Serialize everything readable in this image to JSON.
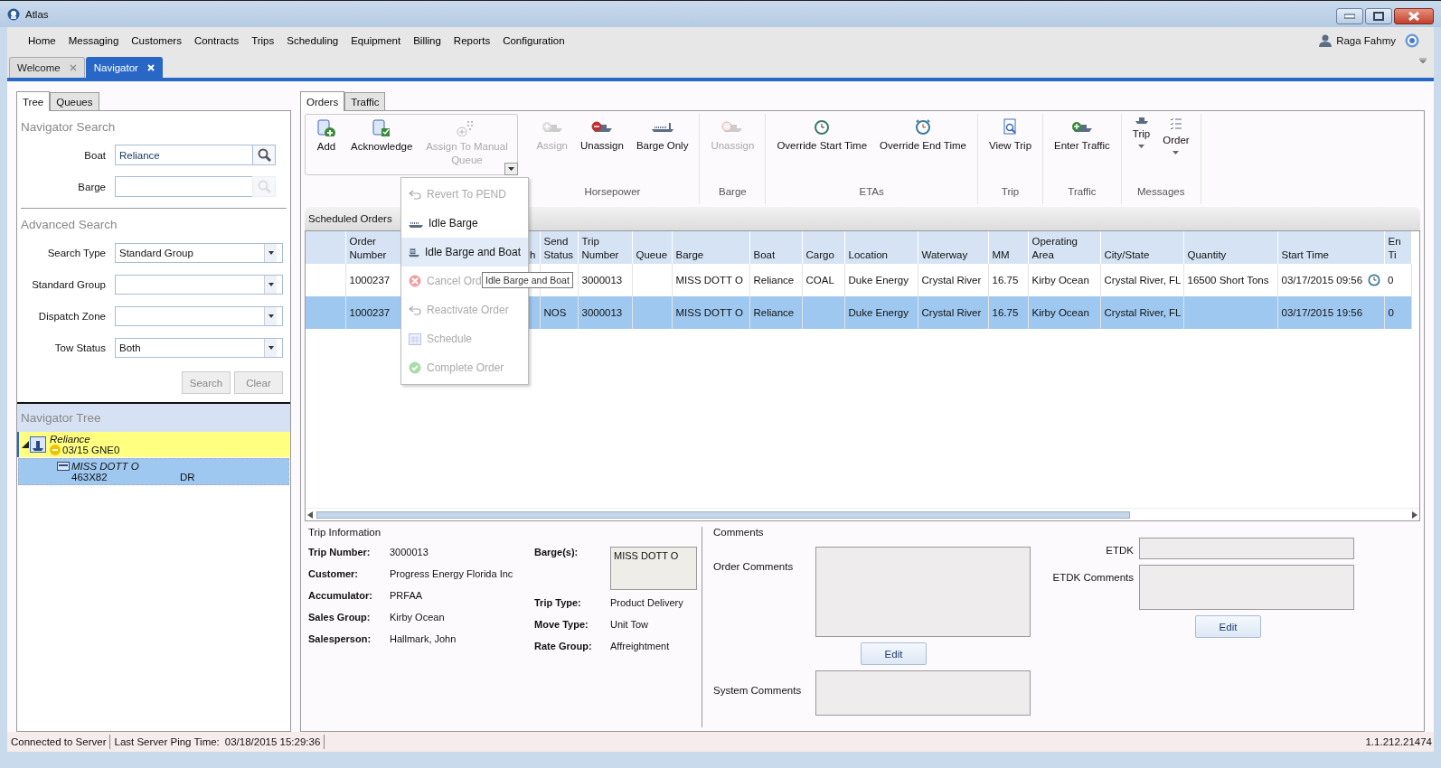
{
  "window": {
    "title": "Atlas"
  },
  "menu": [
    "Home",
    "Messaging",
    "Customers",
    "Contracts",
    "Trips",
    "Scheduling",
    "Equipment",
    "Billing",
    "Reports",
    "Configuration"
  ],
  "user": {
    "name": "Raga Fahmy"
  },
  "doc_tabs": [
    {
      "label": "Welcome",
      "selected": false
    },
    {
      "label": "Navigator",
      "selected": true
    }
  ],
  "left_tabs": [
    {
      "label": "Tree",
      "selected": true
    },
    {
      "label": "Queues",
      "selected": false
    }
  ],
  "navigator_search": {
    "title": "Navigator Search",
    "fields": [
      {
        "label": "Boat",
        "value": "Reliance",
        "disabled": false
      },
      {
        "label": "Barge",
        "disabled": true
      }
    ]
  },
  "advanced_search": {
    "title": "Advanced Search",
    "fields": [
      {
        "label": "Search Type",
        "value": "Standard Group"
      },
      {
        "label": "Standard Group"
      },
      {
        "label": "Dispatch Zone"
      },
      {
        "label": "Tow Status",
        "value": "Both"
      }
    ],
    "buttons": [
      {
        "label": "Search",
        "disabled": true
      },
      {
        "label": "Clear",
        "disabled": true
      }
    ]
  },
  "navigator_tree": {
    "title": "Navigator Tree",
    "nodes": [
      {
        "kind": "boat",
        "name": "Reliance",
        "detail": "03/15  GNE0",
        "expanded": true,
        "selected": false,
        "color": "#ffff80",
        "children": [
          {
            "kind": "barge",
            "name": "MISS DOTT O",
            "detail": "463X82",
            "code": "DR",
            "selected": true
          }
        ]
      }
    ]
  },
  "main_tabs": [
    {
      "label": "Orders",
      "selected": true
    },
    {
      "label": "Traffic",
      "selected": false
    }
  ],
  "ribbon": {
    "groups": [
      {
        "framed": true,
        "buttons": [
          {
            "label": "Add",
            "kind": "add",
            "disabled": false
          },
          {
            "label": "Acknowledge",
            "kind": "acknowledge",
            "disabled": false
          },
          {
            "label": "Assign To Manual Queue",
            "kind": "queue",
            "disabled": true
          }
        ],
        "menu": {
          "items": [
            {
              "label": "Revert To PEND",
              "kind": "undo",
              "disabled": true,
              "hovered": false
            },
            {
              "label": "Idle Barge",
              "kind": "barge",
              "disabled": false,
              "hovered": false
            },
            {
              "label": "Idle Barge and Boat",
              "kind": "boat",
              "disabled": false,
              "hovered": true,
              "tooltip": "Idle Barge and Boat"
            },
            {
              "label": "Cancel Ord",
              "kind": "cancel",
              "disabled": true,
              "hovered": false
            },
            {
              "label": "Reactivate Order",
              "kind": "undo",
              "disabled": true,
              "hovered": false
            },
            {
              "label": "Schedule",
              "kind": "calendar",
              "disabled": true,
              "hovered": false
            },
            {
              "label": "Complete Order",
              "kind": "check",
              "disabled": true,
              "hovered": false
            }
          ]
        }
      },
      {
        "label": "Horsepower",
        "buttons": [
          {
            "label": "Assign",
            "kind": "assign",
            "disabled": true
          },
          {
            "label": "Unassign",
            "kind": "unassign",
            "disabled": false
          },
          {
            "label": "Barge Only",
            "kind": "barge",
            "disabled": false
          }
        ]
      },
      {
        "label": "Barge",
        "buttons": [
          {
            "label": "Unassign",
            "kind": "unassign",
            "disabled": true
          }
        ]
      },
      {
        "label": "ETAs",
        "buttons": [
          {
            "label": "Override Start Time",
            "kind": "clock",
            "disabled": false
          },
          {
            "label": "Override End Time",
            "kind": "alarm",
            "disabled": false
          }
        ]
      },
      {
        "label": "Trip",
        "buttons": [
          {
            "label": "View Trip",
            "kind": "view",
            "disabled": false
          }
        ]
      },
      {
        "label": "Traffic",
        "buttons": [
          {
            "label": "Enter Traffic",
            "kind": "assign",
            "disabled": false
          }
        ]
      },
      {
        "label": "Messages",
        "buttons": [
          {
            "label": "Trip",
            "kind": "boatsmall",
            "disabled": false,
            "dropdown": true
          },
          {
            "label": "Order",
            "kind": "list",
            "disabled": false,
            "dropdown": true
          }
        ]
      }
    ]
  },
  "scheduled_orders": {
    "title": "Scheduled Orders",
    "columns": [
      "Order Number",
      "h",
      "Send Status",
      "Trip Number",
      "Queue",
      "Barge",
      "Boat",
      "Cargo",
      "Location",
      "Waterway",
      "MM",
      "Operating Area",
      "City/State",
      "Quantity",
      "Start Time",
      "En Ti"
    ],
    "rows": [
      {
        "selected": false,
        "alarm": true,
        "cells": [
          "1000237",
          null,
          null,
          "3000013",
          null,
          "MISS DOTT O",
          "Reliance",
          "COAL",
          "Duke Energy",
          "Crystal River",
          "16.75",
          "Kirby Ocean",
          "Crystal River, FL",
          "16500 Short Tons",
          "03/17/2015 09:56",
          "0"
        ]
      },
      {
        "selected": true,
        "alarm": false,
        "cells": [
          "1000237",
          null,
          "NOS",
          "3000013",
          null,
          "MISS DOTT O",
          "Reliance",
          null,
          "Duke Energy",
          "Crystal River",
          "16.75",
          "Kirby Ocean",
          "Crystal River, FL",
          null,
          "03/17/2015 19:56",
          "0"
        ]
      }
    ]
  },
  "trip_information": {
    "title": "Trip Information",
    "left": [
      {
        "label": "Trip Number:",
        "value": "3000013"
      },
      {
        "label": "Customer:",
        "value": "Progress Energy Florida Inc"
      },
      {
        "label": "Accumulator:",
        "value": "PRFAA"
      },
      {
        "label": "Sales Group:",
        "value": "Kirby Ocean"
      },
      {
        "label": "Salesperson:",
        "value": "Hallmark, John"
      }
    ],
    "right": [
      {
        "label": "Barge(s):",
        "value": "MISS DOTT O",
        "kind": "box"
      },
      {
        "label": "Trip Type:",
        "value": "Product Delivery",
        "kind": "text"
      },
      {
        "label": "Move Type:",
        "value": "Unit Tow",
        "kind": "text"
      },
      {
        "label": "Rate Group:",
        "value": "Affreightment",
        "kind": "text"
      }
    ]
  },
  "comments": {
    "title": "Comments",
    "order_comments": "Order Comments",
    "edit": "Edit",
    "system_comments": "System Comments",
    "etdk": "ETDK",
    "etdk_comments": "ETDK Comments",
    "etdk_edit": "Edit"
  },
  "status_bar": {
    "connection": "Connected to Server",
    "ping_label": "Last Server Ping Time:",
    "ping_time": "03/18/2015 15:29:36",
    "version": "1.1.212.21474"
  }
}
